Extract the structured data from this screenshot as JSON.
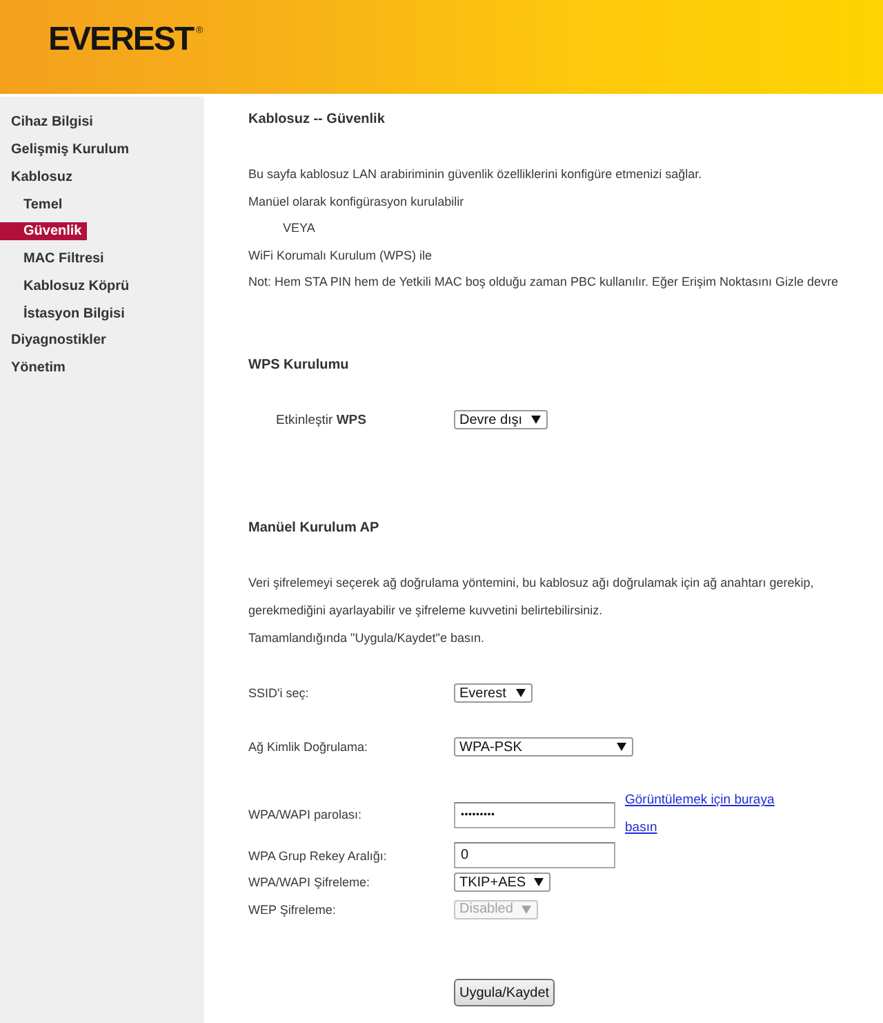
{
  "header": {
    "logo": "EVEREST",
    "logo_mark": "®"
  },
  "sidebar": {
    "items": [
      {
        "label": "Cihaz Bilgisi",
        "selected": false
      },
      {
        "label": "Gelişmiş Kurulum",
        "selected": false
      },
      {
        "label": "Kablosuz",
        "selected": false,
        "children": [
          {
            "label": "Temel",
            "selected": false
          },
          {
            "label": "Güvenlik",
            "selected": true
          },
          {
            "label": "MAC Filtresi",
            "selected": false
          },
          {
            "label": "Kablosuz Köprü",
            "selected": false
          },
          {
            "label": "İstasyon Bilgisi",
            "selected": false
          }
        ]
      },
      {
        "label": "Diyagnostikler",
        "selected": false
      },
      {
        "label": "Yönetim",
        "selected": false
      }
    ]
  },
  "page": {
    "title": "Kablosuz -- Güvenlik",
    "intro": [
      {
        "text": "Bu sayfa kablosuz LAN arabiriminin güvenlik özelliklerini konfigüre etmenizi sağlar.",
        "indented": false
      },
      {
        "text": "Manüel olarak konfigürasyon kurulabilir",
        "indented": false
      },
      {
        "text": "VEYA",
        "indented": true
      },
      {
        "text": "WiFi Korumalı Kurulum (WPS) ile",
        "indented": false
      },
      {
        "text": "Not: Hem STA PIN hem de Yetkili MAC boş olduğu zaman PBC kullanılır. Eğer Erişim Noktasını Gizle devre",
        "indented": false
      }
    ]
  },
  "wps": {
    "heading": "WPS Kurulumu",
    "label": "Etkinleştir **WPS**",
    "value": "Devre dışı",
    "disabled": false
  },
  "manual": {
    "heading": "Manüel Kurulum AP",
    "description": [
      "Veri şifrelemeyi seçerek ağ doğrulama yöntemini, bu kablosuz ağı doğrulamak için ağ anahtarı gerekip,\ngerekmediğini ayarlayabilir ve şifreleme kuvvetini belirtebilirsiniz.",
      "Tamamlandığında \"Uygula/Kaydet\"e basın."
    ],
    "fields": [
      {
        "kind": "select",
        "label": "SSID'i seç:",
        "value": "Everest",
        "disabled": false
      },
      {
        "kind": "select",
        "label": "Ağ Kimlik Doğrulama:",
        "value": "WPA-PSK",
        "disabled": false
      },
      {
        "kind": "password",
        "label": "WPA/WAPI parolası:",
        "value": "•••••••••",
        "link": "Görüntülemek için buraya basın"
      },
      {
        "kind": "text",
        "label": "WPA Grup Rekey Aralığı:",
        "value": "0"
      },
      {
        "kind": "select",
        "label": "WPA/WAPI Şifreleme:",
        "value": "TKIP+AES",
        "disabled": false
      },
      {
        "kind": "select",
        "label": "WEP Şifreleme:",
        "value": "Disabled",
        "disabled": true
      }
    ],
    "button": "Uygula/Kaydet"
  }
}
